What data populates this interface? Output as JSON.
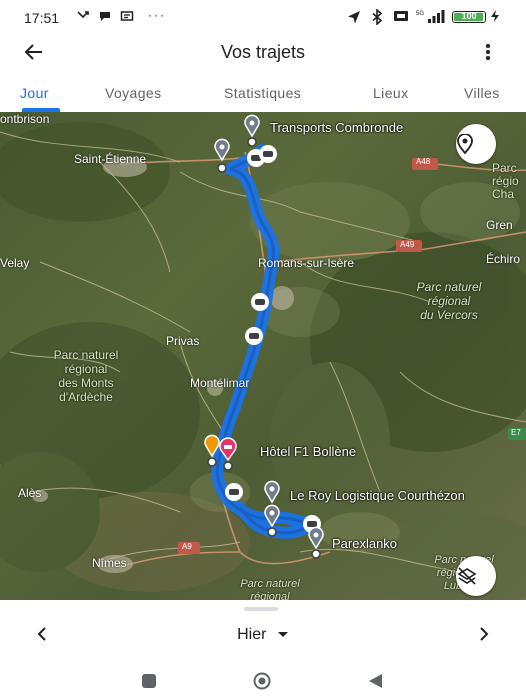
{
  "status_bar": {
    "time": "17:51",
    "battery": "100",
    "dots": "···"
  },
  "header": {
    "title": "Vos trajets"
  },
  "tabs": [
    {
      "label": "Jour",
      "active": true
    },
    {
      "label": "Voyages"
    },
    {
      "label": "Statistiques"
    },
    {
      "label": "Lieux"
    },
    {
      "label": "Villes"
    }
  ],
  "map": {
    "labels": {
      "montbrison": "ontbrison",
      "saint_etienne": "Saint-Étienne",
      "transports": "Transports Combronde",
      "a48": "A48",
      "parc_chartreuse": "Parc\nrégio\nCha",
      "grenoble": "Gren",
      "velay": "Velay",
      "romans": "Romans-sur-Isère",
      "a49": "A49",
      "echirolles": "Échiro",
      "parc_vercors": "Parc naturel\nrégional\ndu Vercors",
      "privas": "Privas",
      "parc_ardeche": "Parc naturel\nrégional\ndes Monts\nd'Ardèche",
      "montelimar": "Montélimar",
      "hotel": "Hôtel F1 Bollène",
      "ales": "Alès",
      "le_roy": "Le Roy Logistique Courthézon",
      "parexlanko": "Parexlanko",
      "a9": "A9",
      "nimes": "Nîmes",
      "parc_luberon": "Parc naturel\nrégional du\nLuberon",
      "parc_bottom": "Parc naturel\nrégional",
      "e7": "E7"
    }
  },
  "day_selector": {
    "label": "Hier"
  }
}
